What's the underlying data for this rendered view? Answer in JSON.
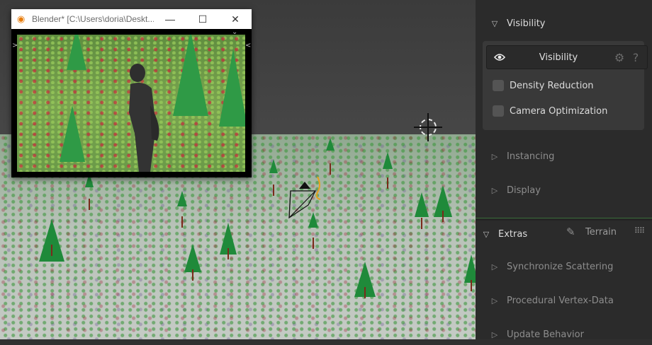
{
  "window": {
    "title": "Blender* [C:\\Users\\doria\\Deskt...",
    "minimize_glyph": "—",
    "maximize_glyph": "☐",
    "close_glyph": "✕"
  },
  "panel": {
    "visibility_section": {
      "label": "Visibility",
      "expanded": true
    },
    "visibility_box": {
      "header_label": "Visibility",
      "options": [
        {
          "label": "Density Reduction",
          "checked": false
        },
        {
          "label": "Camera Optimization",
          "checked": false
        }
      ]
    },
    "instancing_section": {
      "label": "Instancing",
      "expanded": false
    },
    "display_section": {
      "label": "Display",
      "expanded": false
    },
    "extras_section": {
      "label": "Extras",
      "expanded": true,
      "terrain_label": "Terrain"
    },
    "extras_items": [
      {
        "label": "Synchronize Scattering"
      },
      {
        "label": "Procedural Vertex-Data"
      },
      {
        "label": "Update Behavior"
      }
    ]
  },
  "colors": {
    "panel_bg": "#2b2b2b",
    "box_bg": "#393939",
    "blender_orange": "#e87d0d",
    "separator_accent": "#3a6d3a"
  }
}
